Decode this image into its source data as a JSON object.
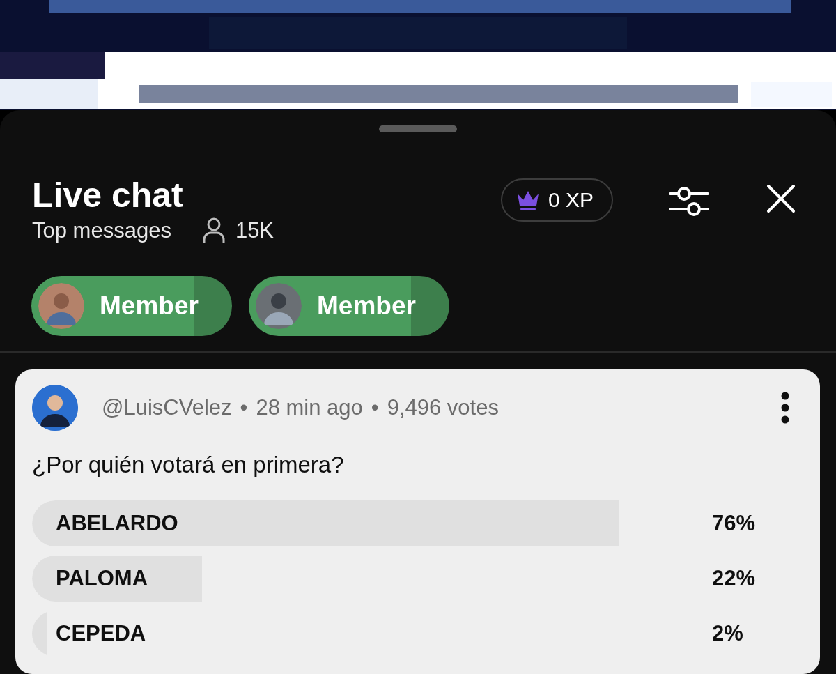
{
  "header": {
    "title": "Live chat",
    "subtitle": "Top messages",
    "viewers": "15K",
    "xp": "0 XP"
  },
  "members": [
    {
      "label": "Member"
    },
    {
      "label": "Member"
    }
  ],
  "poll": {
    "author": "@LuisCVelez",
    "separator": "•",
    "time": "28 min ago",
    "votes": "9,496 votes",
    "question": "¿Por quién votará en primera?",
    "options": [
      {
        "label": "ABELARDO",
        "percent": "76%",
        "level": 0.76
      },
      {
        "label": "PALOMA",
        "percent": "22%",
        "level": 0.22
      },
      {
        "label": "CEPEDA",
        "percent": "2%",
        "level": 0.02
      }
    ]
  }
}
